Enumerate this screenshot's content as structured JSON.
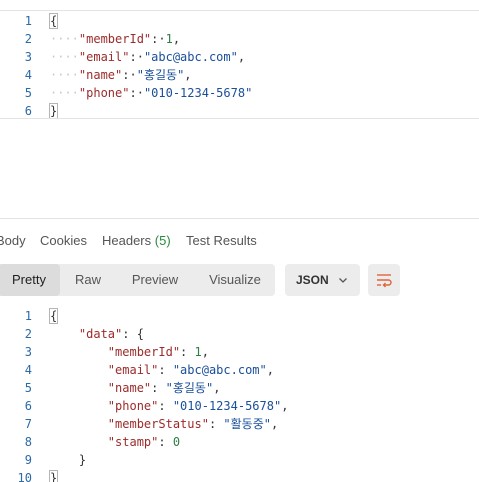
{
  "request_body": {
    "lines": [
      {
        "n": "1",
        "indent": "",
        "parts": [
          {
            "t": "{",
            "c": "pun"
          }
        ]
      },
      {
        "n": "2",
        "indent": "····",
        "parts": [
          {
            "t": "\"memberId\"",
            "c": "key"
          },
          {
            "t": ":·",
            "c": "pun"
          },
          {
            "t": "1",
            "c": "num"
          },
          {
            "t": ",",
            "c": "pun"
          }
        ]
      },
      {
        "n": "3",
        "indent": "····",
        "parts": [
          {
            "t": "\"email\"",
            "c": "key"
          },
          {
            "t": ":·",
            "c": "pun"
          },
          {
            "t": "\"abc@abc.com\"",
            "c": "str"
          },
          {
            "t": ",",
            "c": "pun"
          }
        ]
      },
      {
        "n": "4",
        "indent": "····",
        "parts": [
          {
            "t": "\"name\"",
            "c": "key"
          },
          {
            "t": ":·",
            "c": "pun"
          },
          {
            "t": "\"홍길동\"",
            "c": "str"
          },
          {
            "t": ",",
            "c": "pun"
          }
        ]
      },
      {
        "n": "5",
        "indent": "····",
        "parts": [
          {
            "t": "\"phone\"",
            "c": "key"
          },
          {
            "t": ":·",
            "c": "pun"
          },
          {
            "t": "\"010-1234-5678\"",
            "c": "str"
          }
        ]
      },
      {
        "n": "6",
        "indent": "",
        "parts": [
          {
            "t": "}",
            "c": "pun"
          }
        ]
      }
    ]
  },
  "response_tabs": [
    {
      "label": "Body",
      "count": "",
      "active": true
    },
    {
      "label": "Cookies",
      "count": "",
      "active": false
    },
    {
      "label": "Headers",
      "count": "(5)",
      "active": false
    },
    {
      "label": "Test Results",
      "count": "",
      "active": false
    }
  ],
  "view_modes": [
    {
      "label": "Pretty",
      "active": true
    },
    {
      "label": "Raw",
      "active": false
    },
    {
      "label": "Preview",
      "active": false
    },
    {
      "label": "Visualize",
      "active": false
    }
  ],
  "format_select": {
    "value": "JSON",
    "icon": "chevron-down-icon"
  },
  "wrap_button": {
    "icon": "wrap-lines-icon",
    "color": "#e0653b"
  },
  "response_body": {
    "lines": [
      {
        "n": "1",
        "indent": "",
        "parts": [
          {
            "t": "{",
            "c": "pun"
          }
        ]
      },
      {
        "n": "2",
        "indent": "    ",
        "parts": [
          {
            "t": "\"data\"",
            "c": "key"
          },
          {
            "t": ": {",
            "c": "pun"
          }
        ]
      },
      {
        "n": "3",
        "indent": "        ",
        "parts": [
          {
            "t": "\"memberId\"",
            "c": "key"
          },
          {
            "t": ": ",
            "c": "pun"
          },
          {
            "t": "1",
            "c": "num"
          },
          {
            "t": ",",
            "c": "pun"
          }
        ]
      },
      {
        "n": "4",
        "indent": "        ",
        "parts": [
          {
            "t": "\"email\"",
            "c": "key"
          },
          {
            "t": ": ",
            "c": "pun"
          },
          {
            "t": "\"abc@abc.com\"",
            "c": "str"
          },
          {
            "t": ",",
            "c": "pun"
          }
        ]
      },
      {
        "n": "5",
        "indent": "        ",
        "parts": [
          {
            "t": "\"name\"",
            "c": "key"
          },
          {
            "t": ": ",
            "c": "pun"
          },
          {
            "t": "\"홍길동\"",
            "c": "str"
          },
          {
            "t": ",",
            "c": "pun"
          }
        ]
      },
      {
        "n": "6",
        "indent": "        ",
        "parts": [
          {
            "t": "\"phone\"",
            "c": "key"
          },
          {
            "t": ": ",
            "c": "pun"
          },
          {
            "t": "\"010-1234-5678\"",
            "c": "str"
          },
          {
            "t": ",",
            "c": "pun"
          }
        ]
      },
      {
        "n": "7",
        "indent": "        ",
        "parts": [
          {
            "t": "\"memberStatus\"",
            "c": "key"
          },
          {
            "t": ": ",
            "c": "pun"
          },
          {
            "t": "\"활동중\"",
            "c": "str"
          },
          {
            "t": ",",
            "c": "pun"
          }
        ]
      },
      {
        "n": "8",
        "indent": "        ",
        "parts": [
          {
            "t": "\"stamp\"",
            "c": "key"
          },
          {
            "t": ": ",
            "c": "pun"
          },
          {
            "t": "0",
            "c": "num"
          }
        ]
      },
      {
        "n": "9",
        "indent": "    ",
        "parts": [
          {
            "t": "}",
            "c": "pun"
          }
        ]
      },
      {
        "n": "10",
        "indent": "",
        "parts": [
          {
            "t": "}",
            "c": "pun"
          }
        ]
      }
    ]
  }
}
